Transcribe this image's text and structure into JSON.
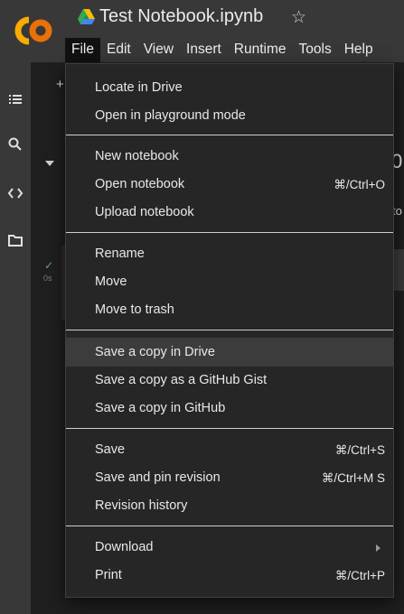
{
  "app": {
    "notebook_title": "Test Notebook.ipynb",
    "star_glyph": "☆",
    "logo_color_left": "#f9ab00",
    "logo_color_right": "#e8710a"
  },
  "menubar": {
    "items": [
      {
        "label": "File",
        "active": true
      },
      {
        "label": "Edit"
      },
      {
        "label": "View"
      },
      {
        "label": "Insert"
      },
      {
        "label": "Runtime"
      },
      {
        "label": "Tools"
      },
      {
        "label": "Help"
      }
    ]
  },
  "sidebar": {
    "icons": [
      "table-of-contents-icon",
      "search-icon",
      "code-snippets-icon",
      "files-folder-icon"
    ]
  },
  "background": {
    "plus_glyph": "+",
    "heading_fragment": "0",
    "text_fragment": "to",
    "cell_status_check": "✓",
    "cell_run_time": "0s"
  },
  "file_menu": {
    "groups": [
      {
        "items": [
          {
            "label": "Locate in Drive",
            "shortcut": ""
          },
          {
            "label": "Open in playground mode",
            "shortcut": ""
          }
        ]
      },
      {
        "items": [
          {
            "label": "New notebook",
            "shortcut": ""
          },
          {
            "label": "Open notebook",
            "shortcut": "⌘/Ctrl+O"
          },
          {
            "label": "Upload notebook",
            "shortcut": ""
          }
        ]
      },
      {
        "items": [
          {
            "label": "Rename",
            "shortcut": ""
          },
          {
            "label": "Move",
            "shortcut": ""
          },
          {
            "label": "Move to trash",
            "shortcut": ""
          }
        ]
      },
      {
        "items": [
          {
            "label": "Save a copy in Drive",
            "shortcut": "",
            "highlighted": true
          },
          {
            "label": "Save a copy as a GitHub Gist",
            "shortcut": ""
          },
          {
            "label": "Save a copy in GitHub",
            "shortcut": ""
          }
        ]
      },
      {
        "items": [
          {
            "label": "Save",
            "shortcut": "⌘/Ctrl+S"
          },
          {
            "label": "Save and pin revision",
            "shortcut": "⌘/Ctrl+M S"
          },
          {
            "label": "Revision history",
            "shortcut": ""
          }
        ]
      },
      {
        "items": [
          {
            "label": "Download",
            "shortcut": "",
            "submenu": true
          },
          {
            "label": "Print",
            "shortcut": "⌘/Ctrl+P"
          }
        ]
      }
    ]
  }
}
